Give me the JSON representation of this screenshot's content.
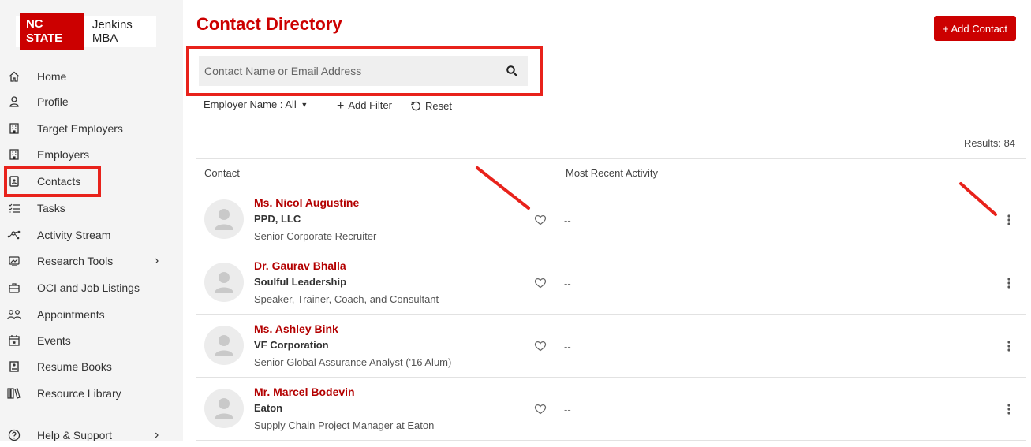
{
  "brand": {
    "badge": "NC STATE",
    "name": "Jenkins MBA"
  },
  "sidebar": {
    "items": [
      {
        "label": "Home",
        "icon": "home-icon"
      },
      {
        "label": "Profile",
        "icon": "user-icon"
      },
      {
        "label": "Target Employers",
        "icon": "building-icon"
      },
      {
        "label": "Employers",
        "icon": "building-icon"
      },
      {
        "label": "Contacts",
        "icon": "contact-card-icon"
      },
      {
        "label": "Tasks",
        "icon": "checklist-icon"
      },
      {
        "label": "Activity Stream",
        "icon": "activity-icon"
      },
      {
        "label": "Research Tools",
        "icon": "research-icon"
      },
      {
        "label": "OCI and Job Listings",
        "icon": "briefcase-icon"
      },
      {
        "label": "Appointments",
        "icon": "people-icon"
      },
      {
        "label": "Events",
        "icon": "calendar-icon"
      },
      {
        "label": "Resume Books",
        "icon": "book-icon"
      },
      {
        "label": "Resource Library",
        "icon": "library-icon"
      },
      {
        "label": "Help & Support",
        "icon": "help-icon"
      }
    ],
    "active": "Contacts"
  },
  "header": {
    "title": "Contact Directory",
    "add_button": "+ Add Contact"
  },
  "search": {
    "placeholder": "Contact Name or Email Address",
    "value": ""
  },
  "filters": {
    "employer": "Employer Name : All",
    "add_filter": "Add Filter",
    "reset": "Reset"
  },
  "results_label": "Results: 84",
  "table": {
    "columns": [
      "Contact",
      "Most Recent Activity"
    ],
    "rows": [
      {
        "name": "Ms. Nicol Augustine",
        "company": "PPD, LLC",
        "title": "Senior Corporate Recruiter",
        "activity": "--"
      },
      {
        "name": "Dr. Gaurav Bhalla",
        "company": "Soulful Leadership",
        "title": "Speaker, Trainer, Coach, and Consultant",
        "activity": "--"
      },
      {
        "name": "Ms. Ashley Bink",
        "company": "VF Corporation",
        "title": "Senior Global Assurance Analyst ('16 Alum)",
        "activity": "--"
      },
      {
        "name": "Mr. Marcel Bodevin",
        "company": "Eaton",
        "title": "Supply Chain Project Manager at Eaton",
        "activity": "--"
      }
    ]
  },
  "colors": {
    "brand_red": "#cc0000",
    "annotation_red": "#e8221b"
  }
}
